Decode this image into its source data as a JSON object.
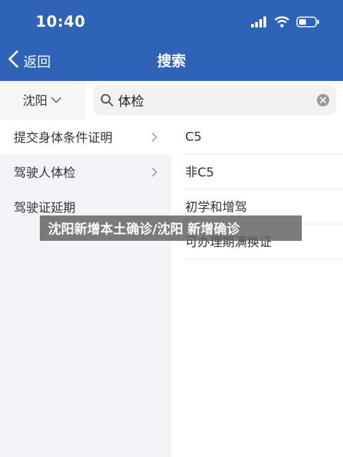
{
  "status_bar": {
    "time": "10:40"
  },
  "nav": {
    "back_label": "返回",
    "title": "搜索"
  },
  "search": {
    "city": "沈阳",
    "query": "体检"
  },
  "left_items": [
    {
      "label": "提交身体条件证明",
      "active": true
    },
    {
      "label": "驾驶人体检",
      "active": false
    },
    {
      "label": "驾驶证延期",
      "active": false
    }
  ],
  "right_items": [
    "C5",
    "非C5",
    "初学和增驾",
    "可办理期满换证"
  ],
  "watermark": "沈阳新增本土确诊/沈阳 新增确诊",
  "colors": {
    "header": "#2e63b7",
    "left_panel_bg": "#f2f4f7"
  }
}
